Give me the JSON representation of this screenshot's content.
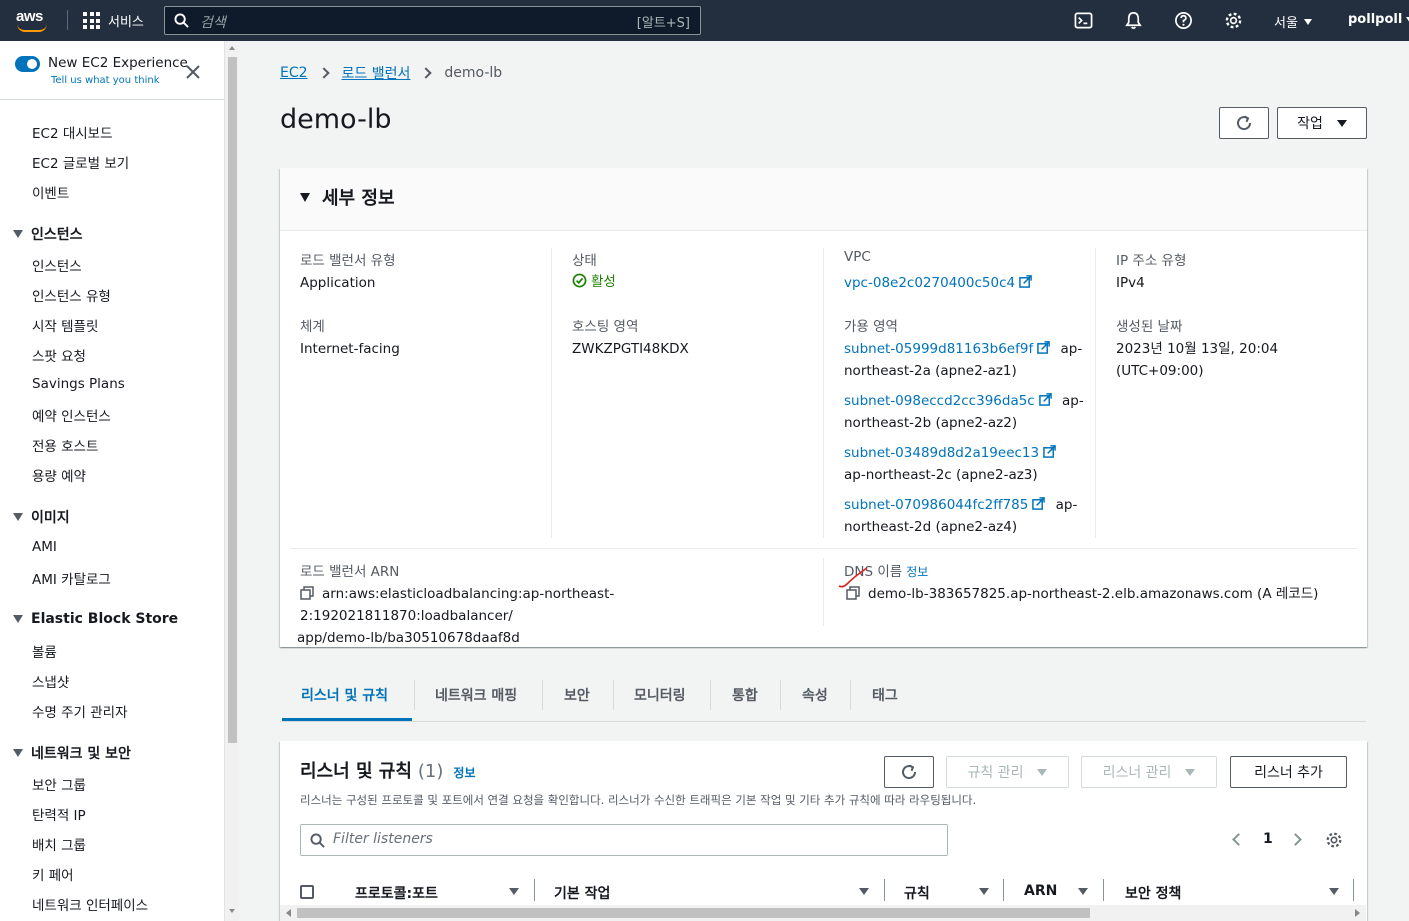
{
  "topnav": {
    "logo_text": "aws",
    "services_label": "서비스",
    "search_placeholder": "검색",
    "search_shortcut": "[알트+S]",
    "region": "서울",
    "user": "pollpoll"
  },
  "sidebar": {
    "toggle_title": "New EC2 Experience",
    "toggle_subtitle": "Tell us what you think",
    "top_items": [
      "EC2 대시보드",
      "EC2 글로벌 보기",
      "이벤트"
    ],
    "sections": [
      {
        "title": "인스턴스",
        "items": [
          "인스턴스",
          "인스턴스 유형",
          "시작 템플릿",
          "스팟 요청",
          "Savings Plans",
          "예약 인스턴스",
          "전용 호스트",
          "용량 예약"
        ]
      },
      {
        "title": "이미지",
        "items": [
          "AMI",
          "AMI 카탈로그"
        ]
      },
      {
        "title": "Elastic Block Store",
        "items": [
          "볼륨",
          "스냅샷",
          "수명 주기 관리자"
        ]
      },
      {
        "title": "네트워크 및 보안",
        "items": [
          "보안 그룹",
          "탄력적 IP",
          "배치 그룹",
          "키 페어",
          "네트워크 인터페이스"
        ]
      }
    ]
  },
  "breadcrumb": {
    "root": "EC2",
    "parent": "로드 밸런서",
    "current": "demo-lb"
  },
  "page": {
    "title": "demo-lb",
    "actions_label": "작업"
  },
  "details": {
    "title": "세부 정보",
    "lb_type_label": "로드 밸런서 유형",
    "lb_type_value": "Application",
    "scheme_label": "체계",
    "scheme_value": "Internet-facing",
    "state_label": "상태",
    "state_value": "활성",
    "hosted_zone_label": "호스팅 영역",
    "hosted_zone_value": "ZWKZPGTI48KDX",
    "vpc_label": "VPC",
    "vpc_value": "vpc-08e2c0270400c50c4",
    "az_label": "가용 영역",
    "subnets": [
      {
        "id": "subnet-05999d81163b6ef9f",
        "zone_a": "ap-",
        "zone_b": "northeast-2a (apne2-az1)"
      },
      {
        "id": "subnet-098eccd2cc396da5c",
        "zone_a": "ap-",
        "zone_b": "northeast-2b (apne2-az2)"
      },
      {
        "id": "subnet-03489d8d2a19eec13",
        "zone_a": "",
        "zone_b": "ap-northeast-2c (apne2-az3)"
      },
      {
        "id": "subnet-070986044fc2ff785",
        "zone_a": "ap-",
        "zone_b": "northeast-2d (apne2-az4)"
      }
    ],
    "ip_type_label": "IP 주소 유형",
    "ip_type_value": "IPv4",
    "created_label": "생성된 날짜",
    "created_value_1": "2023년 10월 13일, 20:04",
    "created_value_2": "(UTC+09:00)",
    "arn_label": "로드 밸런서 ARN",
    "arn_value_1": "arn:aws:elasticloadbalancing:ap-northeast-2:192021811870:loadbalancer/",
    "arn_value_2": "app/demo-lb/ba30510678daaf8d",
    "dns_label": "DNS 이름",
    "dns_info": "정보",
    "dns_value": "demo-lb-383657825.ap-northeast-2.elb.amazonaws.com (A 레코드)"
  },
  "tabs": [
    "리스너 및 규칙",
    "네트워크 매핑",
    "보안",
    "모니터링",
    "통합",
    "속성",
    "태그"
  ],
  "listeners": {
    "title": "리스너 및 규칙",
    "count": "(1)",
    "info": "정보",
    "description": "리스너는 구성된 프로토콜 및 포트에서 연결 요청을 확인합니다. 리스너가 수신한 트래픽은 기본 작업 및 기타 추가 규칙에 따라 라우팅됩니다.",
    "manage_rules": "규칙 관리",
    "manage_listener": "리스너 관리",
    "add_listener": "리스너 추가",
    "filter_placeholder": "Filter listeners",
    "page_number": "1",
    "columns": [
      "프로토콜:포트",
      "기본 작업",
      "규칙",
      "ARN",
      "보안 정책"
    ]
  },
  "colors": {
    "nav_bg": "#232f3e",
    "accent": "#0073bb",
    "success": "#1d8102",
    "smile": "#ff9900"
  }
}
